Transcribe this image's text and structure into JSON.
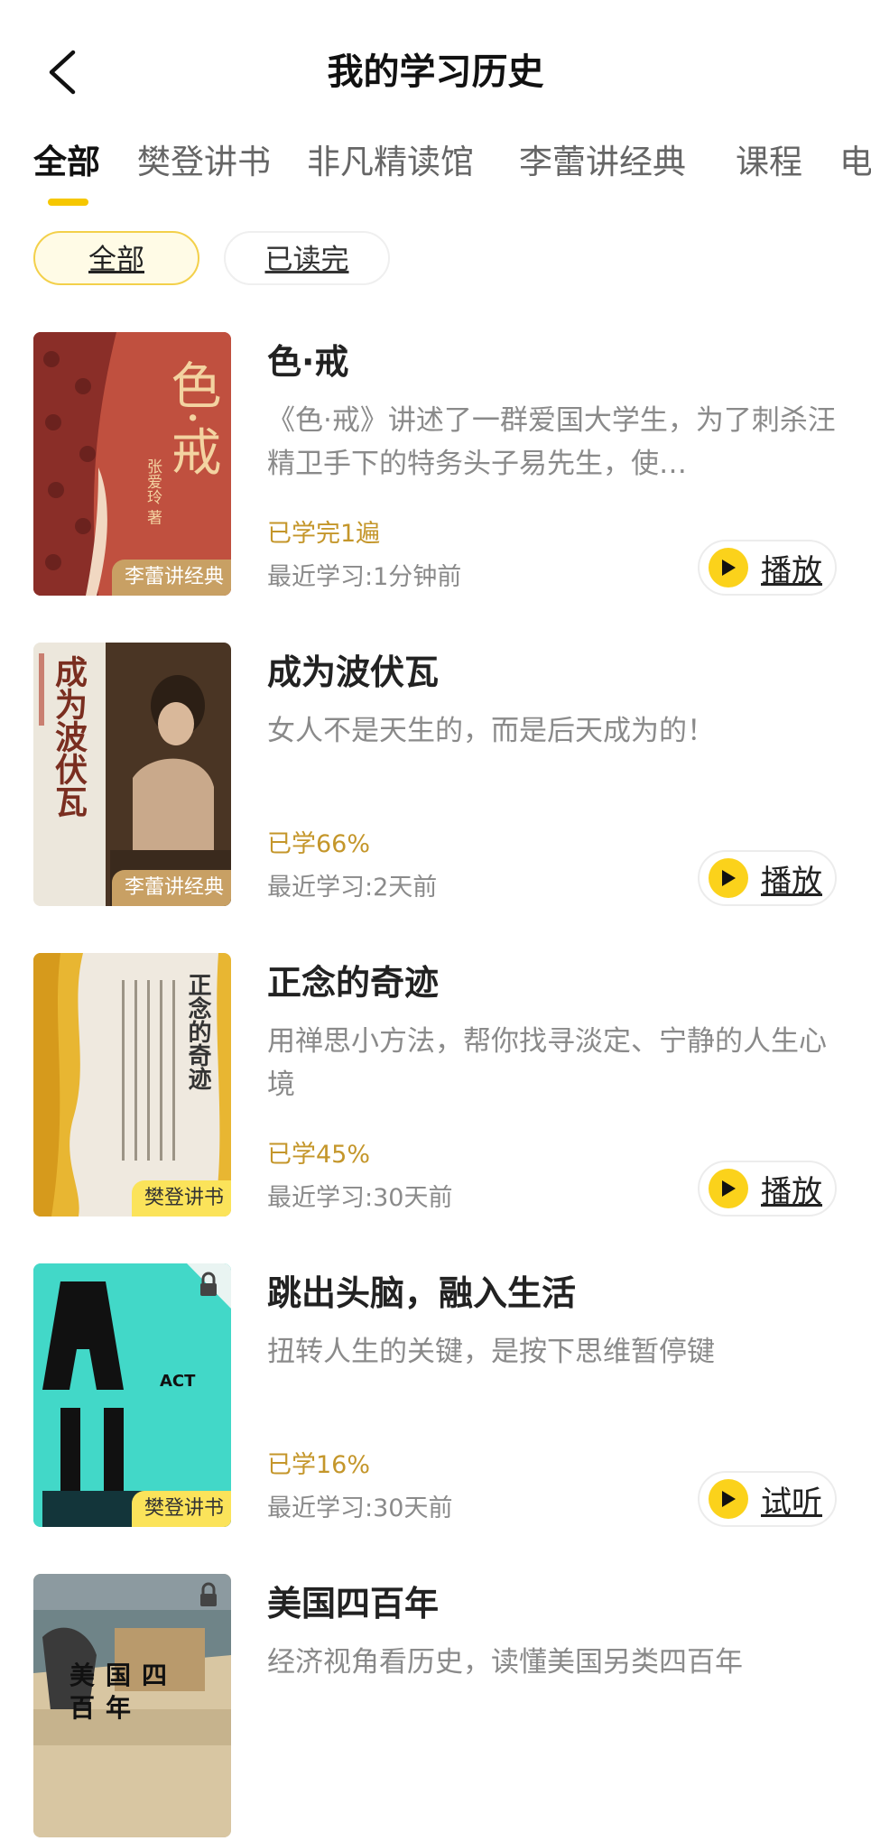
{
  "header": {
    "title": "我的学习历史"
  },
  "tabs": [
    {
      "label": "全部"
    },
    {
      "label": "樊登讲书"
    },
    {
      "label": "非凡精读馆"
    },
    {
      "label": "李蕾讲经典"
    },
    {
      "label": "课程"
    },
    {
      "label": "电"
    }
  ],
  "filters": {
    "all": "全部",
    "finished": "已读完"
  },
  "items": [
    {
      "title": "色·戒",
      "desc": "《色·戒》讲述了一群爱国大学生，为了刺杀汪精卫手下的特务头子易先生，使…",
      "progress": "已学完1遍",
      "recent": "最近学习:1分钟前",
      "tag": "李蕾讲经典",
      "action": "播放",
      "cover_title": "色·戒",
      "cover_author": "张爱玲 著"
    },
    {
      "title": "成为波伏瓦",
      "desc": "女人不是天生的，而是后天成为的！",
      "progress": "已学66%",
      "recent": "最近学习:2天前",
      "tag": "李蕾讲经典",
      "action": "播放",
      "cover_title": "成为波伏瓦"
    },
    {
      "title": "正念的奇迹",
      "desc": "用禅思小方法，帮你找寻淡定、宁静的人生心境",
      "progress": "已学45%",
      "recent": "最近学习:30天前",
      "tag": "樊登讲书",
      "action": "播放",
      "cover_title": "正念的奇迹"
    },
    {
      "title": "跳出头脑，融入生活",
      "desc": "扭转人生的关键，是按下思维暂停键",
      "progress": "已学16%",
      "recent": "最近学习:30天前",
      "tag": "樊登讲书",
      "action": "试听",
      "cover_title": "ACT"
    },
    {
      "title": "美国四百年",
      "desc": "经济视角看历史，读懂美国另类四百年",
      "progress": "",
      "recent": "",
      "tag": "",
      "action": "",
      "cover_title": "美国四百年"
    }
  ],
  "colors": {
    "accent": "#f6c700",
    "progress": "#c4962a"
  }
}
